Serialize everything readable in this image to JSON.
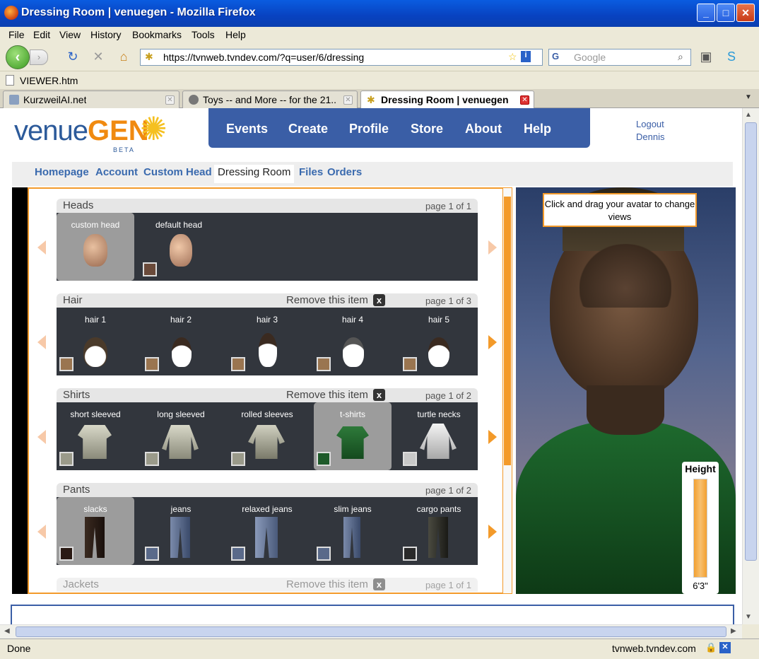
{
  "window": {
    "title": "Dressing Room | venuegen - Mozilla Firefox"
  },
  "menu": [
    "File",
    "Edit",
    "View",
    "History",
    "Bookmarks",
    "Tools",
    "Help"
  ],
  "nav": {
    "url": "https://tvnweb.tvndev.com/?q=user/6/dressing",
    "search_placeholder": "Google"
  },
  "bookmarks": {
    "item": "VIEWER.htm"
  },
  "tabs": [
    {
      "label": "KurzweilAI.net",
      "active": false
    },
    {
      "label": "Toys -- and More -- for the 21...",
      "active": false
    },
    {
      "label": "Dressing Room | venuegen",
      "active": true
    }
  ],
  "site": {
    "logo_text1": "venue",
    "logo_text2": "GEN",
    "logo_beta": "BETA",
    "mainnav": [
      "Events",
      "Create",
      "Profile",
      "Store",
      "About",
      "Help"
    ],
    "logout": "Logout",
    "username": "Dennis",
    "subnav": [
      "Homepage",
      "Account",
      "Custom Head",
      "Dressing Room",
      "Files",
      "Orders"
    ],
    "subnav_current": "Dressing Room"
  },
  "sections": [
    {
      "name": "Heads",
      "page": "page 1 of 1",
      "remove": "",
      "items": [
        {
          "label": "custom head",
          "swatch": "",
          "selected": true
        },
        {
          "label": "default head",
          "swatch": "#6a4a3a",
          "selected": false
        }
      ]
    },
    {
      "name": "Hair",
      "page": "page 1 of 3",
      "remove": "Remove this item",
      "items": [
        {
          "label": "hair 1",
          "swatch": "#9a7550"
        },
        {
          "label": "hair 2",
          "swatch": "#9a7550"
        },
        {
          "label": "hair 3",
          "swatch": "#9a7550"
        },
        {
          "label": "hair 4",
          "swatch": "#9a7550"
        },
        {
          "label": "hair 5",
          "swatch": "#9a7550"
        }
      ]
    },
    {
      "name": "Shirts",
      "page": "page 1 of 2",
      "remove": "Remove this item",
      "items": [
        {
          "label": "short sleeved",
          "swatch": "#9a9a8a"
        },
        {
          "label": "long sleeved",
          "swatch": "#9a9a8a"
        },
        {
          "label": "rolled sleeves",
          "swatch": "#9a9a8a"
        },
        {
          "label": "t-shirts",
          "swatch": "#1e5a2a",
          "selected": true
        },
        {
          "label": "turtle necks",
          "swatch": "#c8c8c8"
        }
      ]
    },
    {
      "name": "Pants",
      "page": "page 1 of 2",
      "remove": "",
      "items": [
        {
          "label": "slacks",
          "swatch": "#2a1a14",
          "selected": true
        },
        {
          "label": "jeans",
          "swatch": "#5a6a8a"
        },
        {
          "label": "relaxed jeans",
          "swatch": "#5a6a8a"
        },
        {
          "label": "slim jeans",
          "swatch": "#5a6a8a"
        },
        {
          "label": "cargo pants",
          "swatch": "#2a2a2a"
        }
      ]
    },
    {
      "name": "Jackets",
      "page": "page 1 of 1",
      "remove": "Remove this item",
      "items": []
    }
  ],
  "viewer": {
    "hint": "Click and drag your avatar to change views",
    "height_label": "Height",
    "height_value": "6'3\""
  },
  "status": {
    "text": "Done",
    "host": "tvnweb.tvndev.com"
  },
  "colors": {
    "accent": "#f39a2a",
    "nav": "#3a5ea6"
  }
}
